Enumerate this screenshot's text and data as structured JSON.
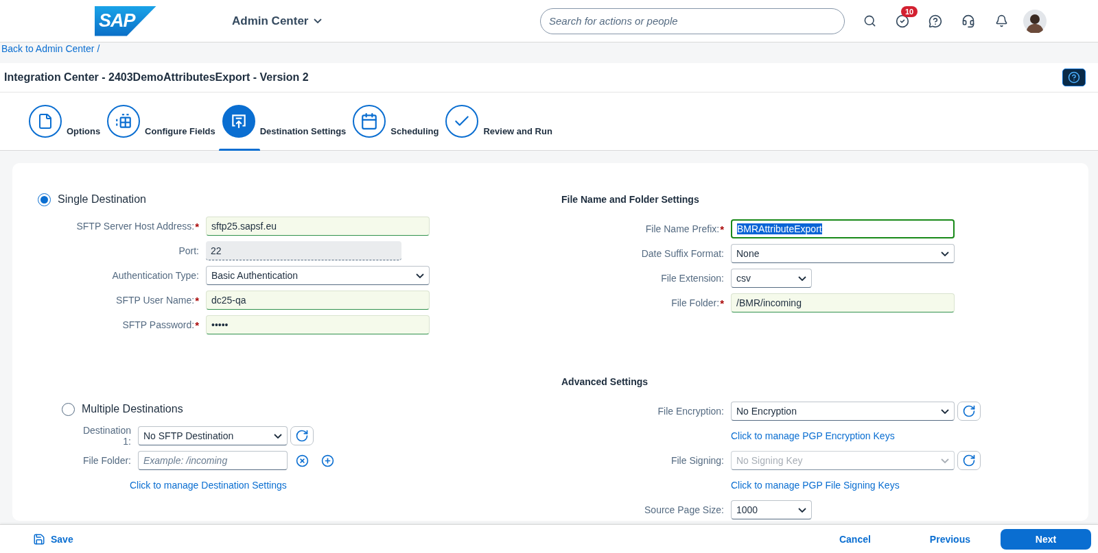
{
  "header": {
    "logo": "SAP",
    "app_menu": "Admin Center",
    "search": {
      "placeholder": "Search for actions or people"
    },
    "task_badge": "10"
  },
  "breadcrumb": {
    "link": "Back to Admin Center",
    "separator": "/"
  },
  "page_title": "Integration Center - 2403DemoAttributesExport - Version 2",
  "steps": [
    {
      "label": "Options",
      "selected": false
    },
    {
      "label": "Configure Fields",
      "selected": false
    },
    {
      "label": "Destination Settings",
      "selected": true
    },
    {
      "label": "Scheduling",
      "selected": false
    },
    {
      "label": "Review and Run",
      "selected": false
    }
  ],
  "single_destination": {
    "label": "Single Destination",
    "selected": true,
    "fields": [
      {
        "kind": "input",
        "label": "SFTP Server Host Address:",
        "required_mark": "*",
        "value": "sftp25.sapsf.eu",
        "valid": true,
        "focused": false
      },
      {
        "kind": "readonly",
        "label": "Port:",
        "value": "22"
      },
      {
        "kind": "select",
        "label": "Authentication Type:",
        "value": "Basic Authentication",
        "disabled": false
      },
      {
        "kind": "input",
        "label": "SFTP User Name:",
        "required_mark": "*",
        "value": "dc25-qa",
        "valid": true,
        "focused": false
      },
      {
        "kind": "input",
        "label": "SFTP Password:",
        "required_mark": "*",
        "value": "•••••",
        "valid": true,
        "focused": false
      }
    ]
  },
  "multiple_destinations": {
    "label": "Multiple Destinations",
    "selected": false,
    "destination": {
      "label": "Destination 1:",
      "value": "No SFTP Destination"
    },
    "file_folder": {
      "label": "File Folder:",
      "placeholder": "Example: /incoming"
    },
    "link": "Click to manage Destination Settings"
  },
  "file_settings": {
    "title": "File Name and Folder Settings",
    "fields": [
      {
        "kind": "input",
        "label": "File Name Prefix:",
        "required_mark": "*",
        "value": "BMRAttributeExport",
        "valid": false,
        "focused": true
      },
      {
        "kind": "select",
        "label": "Date Suffix Format:",
        "value": "None",
        "disabled": false
      },
      {
        "kind": "short_select",
        "label": "File Extension:",
        "value": "csv"
      },
      {
        "kind": "input",
        "label": "File Folder:",
        "required_mark": "*",
        "value": "/BMR/incoming",
        "valid": true,
        "focused": false
      }
    ]
  },
  "advanced_settings": {
    "title": "Advanced Settings",
    "fields": [
      {
        "kind": "select",
        "label": "File Encryption:",
        "value": "No Encryption",
        "disabled": false,
        "refresh": true,
        "link": "Click to manage PGP Encryption Keys"
      },
      {
        "kind": "select",
        "label": "File Signing:",
        "value": "No Signing Key",
        "disabled": true,
        "refresh": true,
        "link": "Click to manage PGP File Signing Keys"
      },
      {
        "kind": "short_select",
        "label": "Source Page Size:",
        "value": "1000"
      }
    ]
  },
  "footer": {
    "save": "Save",
    "buttons": [
      {
        "label": "Cancel",
        "kind": "text"
      },
      {
        "label": "Previous",
        "kind": "text"
      },
      {
        "label": "Next",
        "kind": "primary"
      }
    ]
  }
}
